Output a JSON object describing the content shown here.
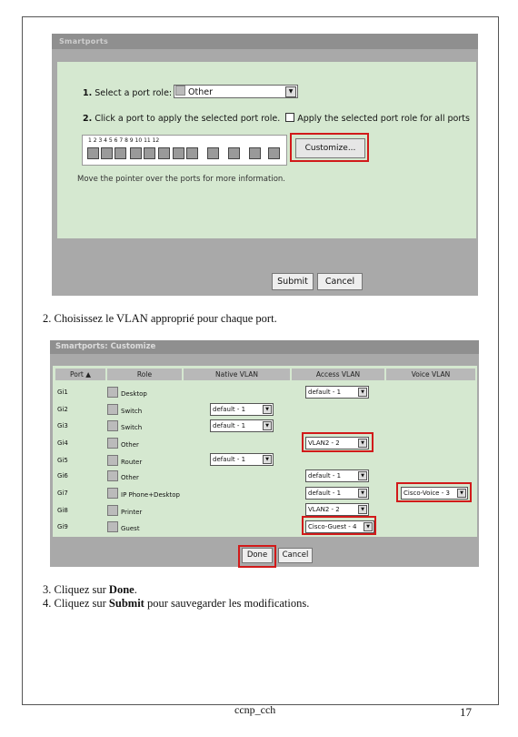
{
  "shot1": {
    "title": "Smartports",
    "step1": {
      "num": "1.",
      "text": "Select a port role:",
      "value": "Other"
    },
    "step2": {
      "num": "2.",
      "text": "Click a port to apply the selected port role.",
      "checkbox_label": "Apply the selected port role for all ports"
    },
    "port_numbers": "1   2   3   4   5   6   7   8      9     10    11    12",
    "customize_label": "Customize...",
    "hint": "Move the pointer over the ports for more information.",
    "submit_label": "Submit",
    "cancel_label": "Cancel"
  },
  "caption2": "2. Choisissez le VLAN approprié pour chaque port.",
  "shot2": {
    "title": "Smartports: Customize",
    "headers": [
      "Port ▲",
      "Role",
      "Native VLAN",
      "Access VLAN",
      "Voice VLAN"
    ],
    "rows": [
      {
        "port": "Gi1",
        "role": "Desktop",
        "native": "",
        "access": "default - 1",
        "voice": ""
      },
      {
        "port": "Gi2",
        "role": "Switch",
        "native": "default - 1",
        "access": "",
        "voice": ""
      },
      {
        "port": "Gi3",
        "role": "Switch",
        "native": "default - 1",
        "access": "",
        "voice": ""
      },
      {
        "port": "Gi4",
        "role": "Other",
        "native": "",
        "access": "VLAN2 - 2",
        "voice": ""
      },
      {
        "port": "Gi5",
        "role": "Router",
        "native": "default - 1",
        "access": "",
        "voice": ""
      },
      {
        "port": "Gi6",
        "role": "Other",
        "native": "",
        "access": "default - 1",
        "voice": ""
      },
      {
        "port": "Gi7",
        "role": "IP Phone+Desktop",
        "native": "",
        "access": "default - 1",
        "voice": "Cisco-Voice - 3"
      },
      {
        "port": "Gi8",
        "role": "Printer",
        "native": "",
        "access": "VLAN2 - 2",
        "voice": ""
      },
      {
        "port": "Gi9",
        "role": "Guest",
        "native": "",
        "access": "Cisco-Guest - 4",
        "voice": ""
      }
    ],
    "done_label": "Done",
    "cancel_label": "Cancel"
  },
  "caption3": {
    "prefix": "3. Cliquez sur ",
    "bold": "Done",
    "suffix": "."
  },
  "caption4": {
    "prefix": "4. Cliquez sur ",
    "bold": "Submit",
    "suffix": " pour sauvegarder les modifications."
  },
  "footer": {
    "left": "ccnp_cch",
    "right": "17"
  },
  "colors": {
    "panel": "#d5e8d0",
    "highlight": "#d11a1a"
  }
}
